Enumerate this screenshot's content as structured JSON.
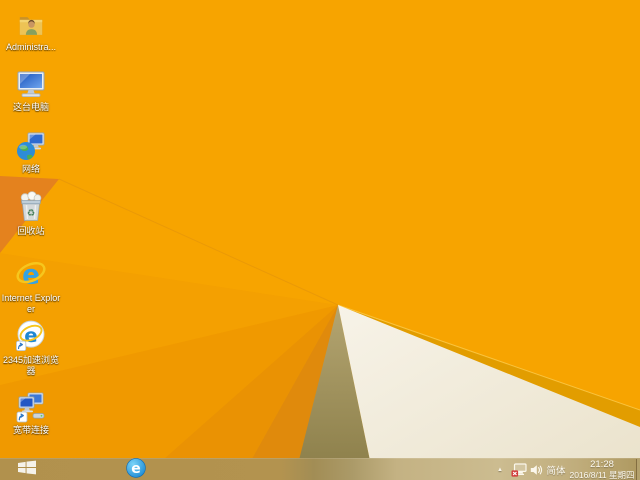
{
  "wallpaper": {
    "base_color": "#F7A400",
    "left_dark_facet_color": "#E4821E",
    "fan_facet_colors": [
      "#F4A001",
      "#F09900",
      "#EA9203",
      "#E08A0C"
    ],
    "stripe_color": "#E29D00",
    "olive_facet_top": "#B4A571",
    "olive_facet_bottom": "#8A7D48",
    "white_facet_top": "#F7F3E8",
    "white_facet_bottom": "#EAE2CB"
  },
  "desktop": {
    "icons": [
      {
        "name": "administrator",
        "label": "Administra...",
        "icon": "user-folder-icon"
      },
      {
        "name": "this-pc",
        "label": "这台电脑",
        "icon": "computer-icon"
      },
      {
        "name": "network",
        "label": "网络",
        "icon": "network-globe-icon"
      },
      {
        "name": "recycle-bin",
        "label": "回收站",
        "icon": "recycle-bin-icon"
      },
      {
        "name": "internet-explorer",
        "label": "Internet Explorer",
        "icon": "ie-icon"
      },
      {
        "name": "2345-browser",
        "label": "2345加速浏览器",
        "icon": "ie-shortcut-icon"
      },
      {
        "name": "broadband",
        "label": "宽带连接",
        "icon": "broadband-shortcut-icon"
      }
    ]
  },
  "taskbar": {
    "background_color": "#B3934F",
    "start_icon": "windows-logo-icon",
    "pinned": [
      {
        "name": "internet-explorer",
        "icon": "ie-circle-icon"
      }
    ],
    "tray": {
      "show_hidden_glyph": "▲",
      "network_icon": "network-disconnected-icon",
      "volume_icon": "speaker-icon",
      "ime_label": "简体",
      "time": "21:28",
      "date": "2016/8/11 星期四"
    }
  }
}
